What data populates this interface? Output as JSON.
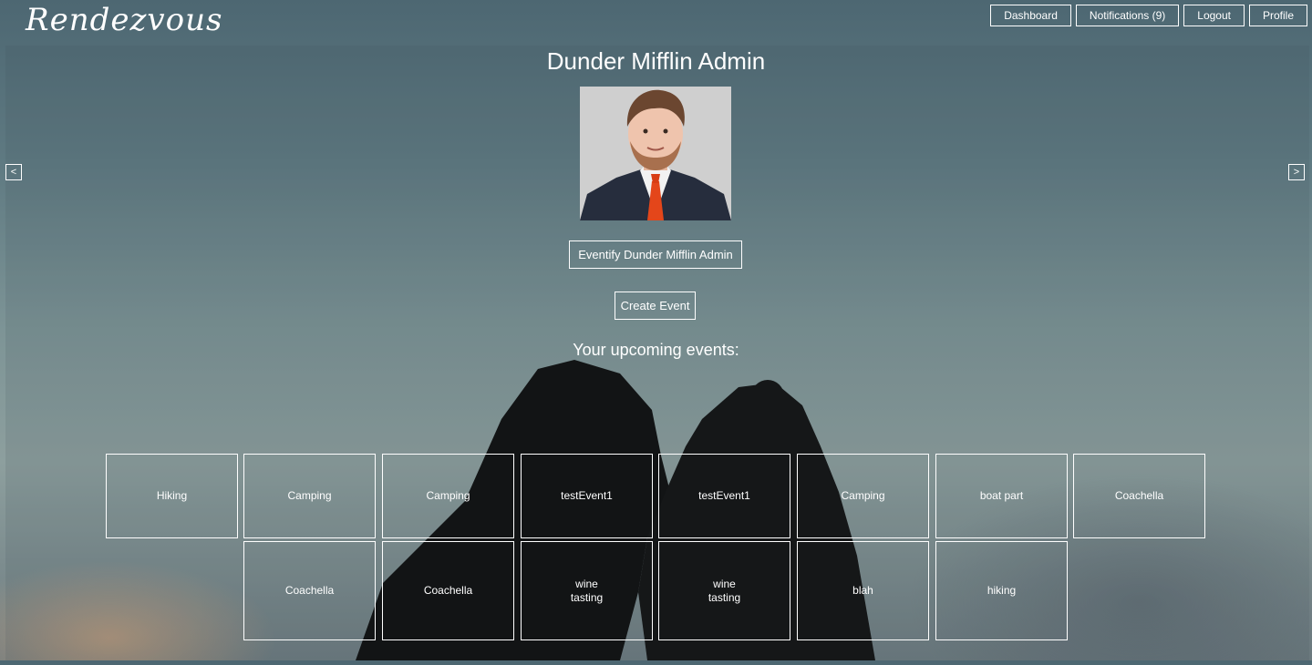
{
  "app": {
    "logo": "Rendezvous"
  },
  "nav": {
    "dashboard": "Dashboard",
    "notifications": "Notifications (9)",
    "logout": "Logout",
    "profile": "Profile"
  },
  "carousel": {
    "prev": "<",
    "next": ">"
  },
  "profile": {
    "name": "Dunder Mifflin Admin",
    "eventify_label": "Eventify Dunder Mifflin Admin",
    "create_event_label": "Create Event"
  },
  "events": {
    "heading": "Your upcoming events:",
    "row1": [
      "Hiking",
      "Camping",
      "Camping",
      "testEvent1",
      "testEvent1",
      "Camping",
      "boat part",
      "Coachella"
    ],
    "row2": [
      "Coachella",
      "Coachella",
      "wine tasting",
      "wine tasting",
      "blah",
      "hiking"
    ]
  }
}
